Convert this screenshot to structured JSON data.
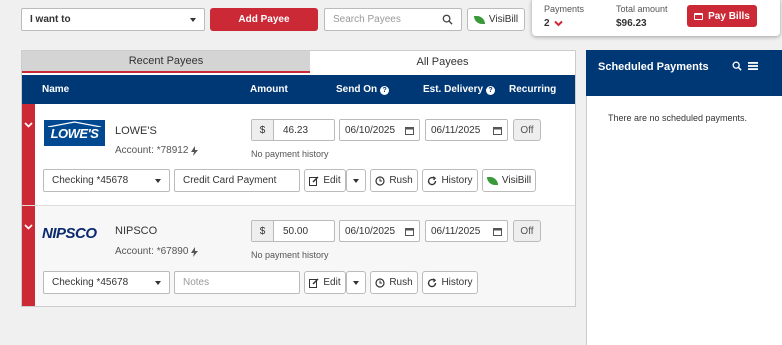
{
  "toolbar": {
    "want_to": "I want to",
    "add_payee": "Add Payee",
    "search_placeholder": "Search Payees",
    "visibill": "VisiBill"
  },
  "summary": {
    "payments_label": "Payments",
    "payments_count": "2",
    "total_label": "Total amount",
    "total_value": "$96.23",
    "pay_bills": "Pay Bills"
  },
  "tabs": {
    "recent": "Recent Payees",
    "all": "All Payees"
  },
  "columns": {
    "name": "Name",
    "amount": "Amount",
    "send_on": "Send On",
    "est_delivery": "Est. Delivery",
    "recurring": "Recurring"
  },
  "payees": [
    {
      "logo": "LOWE'S",
      "name": "LOWE'S",
      "account": "Account: *78912",
      "currency": "$",
      "amount": "46.23",
      "send_on": "06/10/2025",
      "delivery": "06/11/2025",
      "recurring": "Off",
      "history_note": "No payment history",
      "funding": "Checking *45678",
      "memo": "Credit Card Payment",
      "memo_placeholder": "",
      "edit": "Edit",
      "rush": "Rush",
      "history": "History",
      "visibill": "VisiBill"
    },
    {
      "logo": "NIPSCO",
      "name": "NIPSCO",
      "account": "Account: *67890",
      "currency": "$",
      "amount": "50.00",
      "send_on": "06/10/2025",
      "delivery": "06/11/2025",
      "recurring": "Off",
      "history_note": "No payment history",
      "funding": "Checking *45678",
      "memo": "",
      "memo_placeholder": "Notes",
      "edit": "Edit",
      "rush": "Rush",
      "history": "History"
    }
  ],
  "scheduled": {
    "title": "Scheduled Payments",
    "empty": "There are no scheduled payments."
  },
  "colors": {
    "brand_blue": "#003876",
    "accent_red": "#cc2936",
    "lowes_blue": "#004990"
  },
  "icons": [
    "chevron-down-icon",
    "search-icon",
    "leaf-icon",
    "card-icon",
    "calendar-icon",
    "lightning-icon",
    "edit-icon",
    "clock-icon",
    "refresh-icon",
    "menu-icon",
    "question-icon"
  ]
}
